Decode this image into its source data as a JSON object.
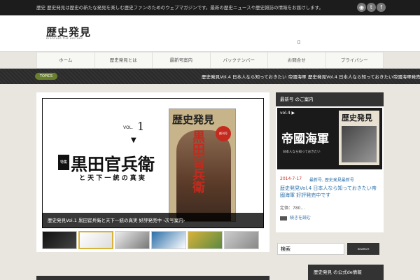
{
  "topbar": {
    "text": "歴史 歴史発見は歴史の新たな発見を楽しむ歴史ファンのためのウェブマガジンです。最新の歴史ニュースや歴史雑誌の情報をお届けします。",
    "social": [
      "rss-icon",
      "twitter-icon",
      "facebook-icon"
    ]
  },
  "header": {
    "logo": "歴史発見",
    "logo_sub": "DISCOVER THE HISTORY",
    "menu_icon": "▯"
  },
  "nav": {
    "items": [
      "ホーム",
      "歴史発見とは",
      "最新号案内",
      "バックナンバー",
      "お問合せ",
      "プライバシー"
    ]
  },
  "topics": {
    "badge": "TOPICS",
    "items": [
      "歴史発見Vol.4 日本人なら知っておきたい 帝國海軍",
      "歴史発見Vol.4 日本人なら知っておきたい帝國海軍発売"
    ]
  },
  "slider": {
    "vol_label": "VOL.",
    "vol_num": "1",
    "arrow": "▼",
    "tag": "特集",
    "headline": "黒田官兵衛",
    "subline": "と 天 下 一 統 の 真 実",
    "magazine_title": "歴史発見",
    "magazine_red": "黒田官兵衛",
    "magazine_badge": "創刊号",
    "caption": "歴史発見Vol.1 黒田官兵衛と天下一統の真実 好評発売中 ‹次号案内›",
    "thumb_count": 6
  },
  "sidebar": {
    "header": "最新号 のご案内",
    "image": {
      "vol": "vol.4 ▶",
      "big": "帝國海軍",
      "small": "日本人なら知っておきたい",
      "cover_title": "歴史発見"
    },
    "date": "2014-7-17",
    "category": "最新号, 歴史発見最新号",
    "title": "歴史発見Vol.4 日本人なら知っておきたい帝國海軍 好評発売中です",
    "excerpt": "定価：780…",
    "more": "続きを読む"
  },
  "search": {
    "value": "検索",
    "button": "SEARCH"
  },
  "bottom": {
    "side_header": "歴史発見 の公式de情報"
  }
}
